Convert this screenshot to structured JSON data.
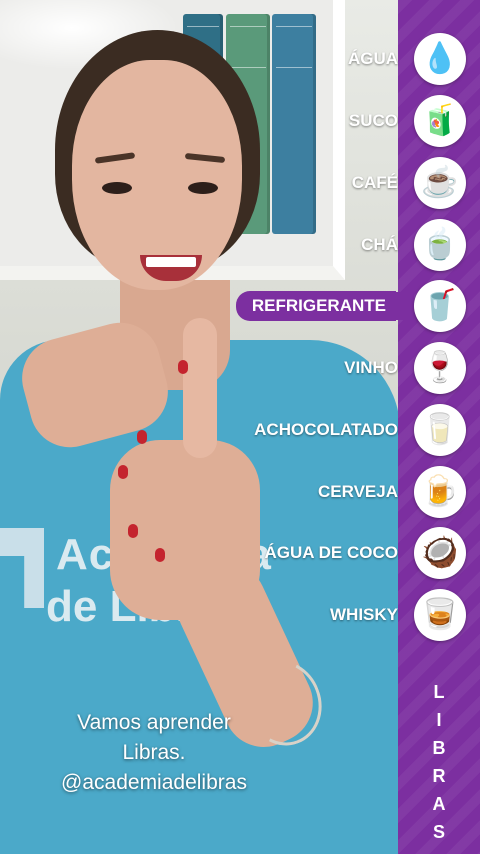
{
  "drinks": [
    {
      "label": "ÁGUA",
      "icon": "water-drop-icon",
      "glyph": "💧"
    },
    {
      "label": "SUCO",
      "icon": "juice-box-icon",
      "glyph": "🧃"
    },
    {
      "label": "CAFÉ",
      "icon": "coffee-cup-icon",
      "glyph": "☕"
    },
    {
      "label": "CHÁ",
      "icon": "tea-cup-icon",
      "glyph": "🍵"
    },
    {
      "label": "REFRIGERANTE",
      "icon": "soda-cup-icon",
      "glyph": "🥤"
    },
    {
      "label": "VINHO",
      "icon": "wine-glass-icon",
      "glyph": "🍷"
    },
    {
      "label": "ACHOCOLATADO",
      "icon": "chocolate-milk-glass-icon",
      "glyph": "🥛"
    },
    {
      "label": "CERVEJA",
      "icon": "beer-mug-icon",
      "glyph": "🍺"
    },
    {
      "label": "ÁGUA DE COCO",
      "icon": "coconut-icon",
      "glyph": "🥥"
    },
    {
      "label": "WHISKY",
      "icon": "whisky-glass-icon",
      "glyph": "🥃"
    }
  ],
  "active_index": 4,
  "caption": {
    "line1": "Vamos aprender",
    "line2": "Libras.",
    "line3": "@academiadelibras"
  },
  "shirt_logo": {
    "line1": "Academia",
    "line2": "de Libras"
  },
  "side_title": [
    "L",
    "I",
    "B",
    "R",
    "A",
    "S"
  ],
  "colors": {
    "panel": "#7c2fa0",
    "shirt": "#4ba9c9"
  }
}
